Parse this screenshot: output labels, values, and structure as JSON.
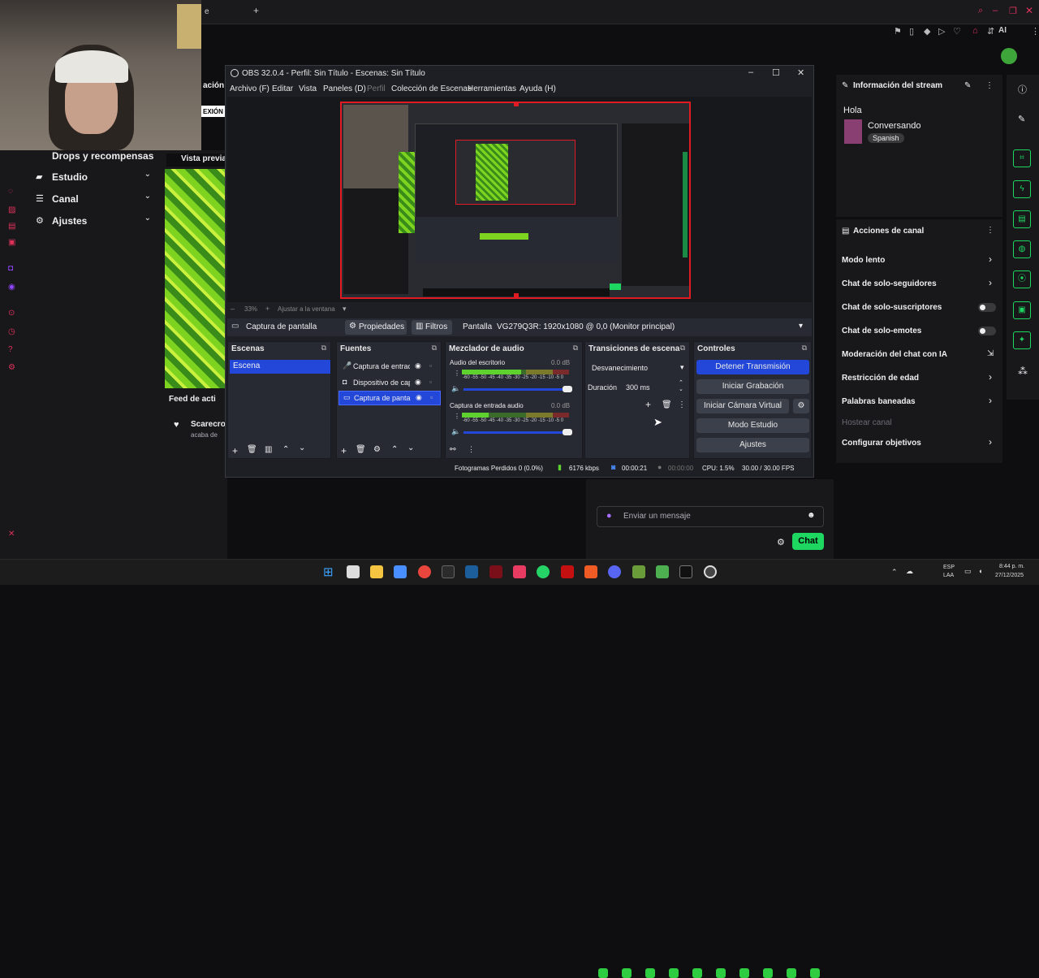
{
  "browser": {
    "tab_label": "e",
    "new_tab": "+",
    "ai_label": "AI"
  },
  "nav": {
    "items": [
      {
        "label": "Drops y recompensas",
        "chevron": ""
      },
      {
        "label": "Estudio",
        "chevron": "⌄"
      },
      {
        "label": "Canal",
        "chevron": "⌄"
      },
      {
        "label": "Ajustes",
        "chevron": "⌄"
      }
    ],
    "preview_label": "Vista previa",
    "conexion_label": "EXIÓN",
    "feed_label": "Feed de acti",
    "feed_user": "Scarecro",
    "feed_sub": "acaba de",
    "cion_label": "ación"
  },
  "stream_info": {
    "title": "Información del stream",
    "greeting": "Hola",
    "category": "Conversando",
    "language": "Spanish"
  },
  "channel_actions": {
    "title": "Acciones de canal",
    "items": [
      {
        "label": "Modo lento",
        "control": "chevron"
      },
      {
        "label": "Chat de solo-seguidores",
        "control": "chevron"
      },
      {
        "label": "Chat de solo-suscriptores",
        "control": "toggle"
      },
      {
        "label": "Chat de solo-emotes",
        "control": "toggle"
      },
      {
        "label": "Moderación del chat con IA",
        "control": "external"
      },
      {
        "label": "Restricción de edad",
        "control": "chevron"
      },
      {
        "label": "Palabras baneadas",
        "control": "chevron"
      },
      {
        "label": "Hostear canal",
        "control": "none"
      },
      {
        "label": "Configurar objetivos",
        "control": "chevron"
      }
    ]
  },
  "obs": {
    "title": "OBS 32.0.4 - Perfil: Sin Título - Escenas: Sin Título",
    "menu": [
      "Archivo (F)",
      "Editar",
      "Vista",
      "Paneles (D)",
      "Perfil",
      "Colección de Escenas",
      "Herramientas",
      "Ayuda (H)"
    ],
    "zoom": "33%",
    "fit_label": "Ajustar a la ventana",
    "source_name": "Captura de pantalla",
    "properties_btn": "Propiedades",
    "filters_btn": "Filtros",
    "display_label": "Pantalla",
    "display_value": "VG279Q3R: 1920x1080 @ 0,0 (Monitor principal)",
    "scenes": {
      "title": "Escenas",
      "items": [
        "Escena"
      ]
    },
    "sources": {
      "title": "Fuentes",
      "items": [
        "Captura de entrac",
        "Dispositivo de cap",
        "Captura de panta"
      ]
    },
    "mixer": {
      "title": "Mezclador de audio",
      "channels": [
        {
          "name": "Audio del escritorio",
          "db": "0.0 dB",
          "level": 0.55
        },
        {
          "name": "Captura de entrada audio",
          "db": "0.0 dB",
          "level": 0.25
        }
      ],
      "scale": "-60 -55 -50 -45 -40 -35 -30 -25 -20 -15 -10 -5 0"
    },
    "transitions": {
      "title": "Transiciones de escena",
      "selected": "Desvanecimiento",
      "duration_label": "Duración",
      "duration_value": "300 ms"
    },
    "controls": {
      "title": "Controles",
      "buttons": [
        "Detener Transmisión",
        "Iniciar Grabación",
        "Iniciar Cámara Virtual",
        "Modo Estudio",
        "Ajustes"
      ]
    },
    "status": {
      "dropped": "Fotogramas Perdidos 0 (0.0%)",
      "bitrate": "6176 kbps",
      "live_time": "00:00:21",
      "rec_time": "00:00:00",
      "cpu": "CPU: 1.5%",
      "fps": "30.00 / 30.00 FPS"
    }
  },
  "chat": {
    "placeholder": "Enviar un mensaje",
    "send_label": "Chat"
  },
  "taskbar": {
    "lang1": "ESP",
    "lang2": "LAA",
    "time": "8:44 p. m.",
    "date": "27/12/2025"
  },
  "colors": {
    "twitch_accent": "#1ed760",
    "obs_active_blue": "#2347d8",
    "preview_border": "#e01b24"
  }
}
